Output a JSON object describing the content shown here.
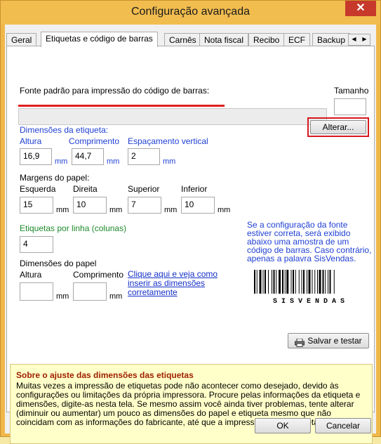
{
  "window": {
    "title": "Configuração avançada",
    "close_label": "✕"
  },
  "tabs": [
    "Geral",
    "Etiquetas e código de barras",
    "Carnês",
    "Nota fiscal",
    "Recibo",
    "ECF",
    "Backup"
  ],
  "tab_scroll": {
    "left": "◀",
    "right": "▶"
  },
  "font_section": {
    "label": "Fonte padrão para impressão do código de barras:",
    "size_label": "Tamanho",
    "size_value": "",
    "change_button": "Alterar..."
  },
  "label_dims": {
    "title": "Dimensões da etiqueta:",
    "height_label": "Altura",
    "height_value": "16,9",
    "length_label": "Comprimento",
    "length_value": "44,7",
    "vspace_label": "Espaçamento vertical",
    "vspace_value": "2",
    "unit": "mm"
  },
  "margins": {
    "title": "Margens do papel:",
    "left_label": "Esquerda",
    "left_value": "15",
    "right_label": "Direita",
    "right_value": "10",
    "top_label": "Superior",
    "top_value": "7",
    "bottom_label": "Inferior",
    "bottom_value": "10",
    "unit": "mm"
  },
  "per_line": {
    "label": "Etiquetas por linha (colunas)",
    "value": "4"
  },
  "paper_dims": {
    "title": "Dimensões do papel",
    "height_label": "Altura",
    "height_value": "",
    "length_label": "Comprimento",
    "length_value": "",
    "unit": "mm",
    "help_link": [
      "Clique aqui e veja como",
      "inserir as dimensões",
      "corretamente"
    ]
  },
  "preview": {
    "note": [
      "Se a configuração da fonte",
      "estiver correta, será exibido",
      "abaixo uma amostra de um",
      "código de barras. Caso contrário,",
      "apenas a palavra SisVendas."
    ],
    "barcode_text": "S I S V E N D A S"
  },
  "save_test_button": "Salvar e testar",
  "info": {
    "title": "Sobre o ajuste das dimensões das etiquetas",
    "body": "Muitas vezes a impressão de etiquetas pode não acontecer como desejado, devido às configurações ou limitações da própria impressora. Procure pelas informações da etiqueta e dimensões, digite-as nesta tela. Se mesmo assim você ainda tiver problemas, tente alterar (diminuir ou aumentar) um pouco as dimensões do papel e etiqueta mesmo que não coincidam com as informações do fabricante, até que a impressão ocorra corretamente."
  },
  "footer": {
    "ok": "OK",
    "cancel": "Cancelar"
  }
}
